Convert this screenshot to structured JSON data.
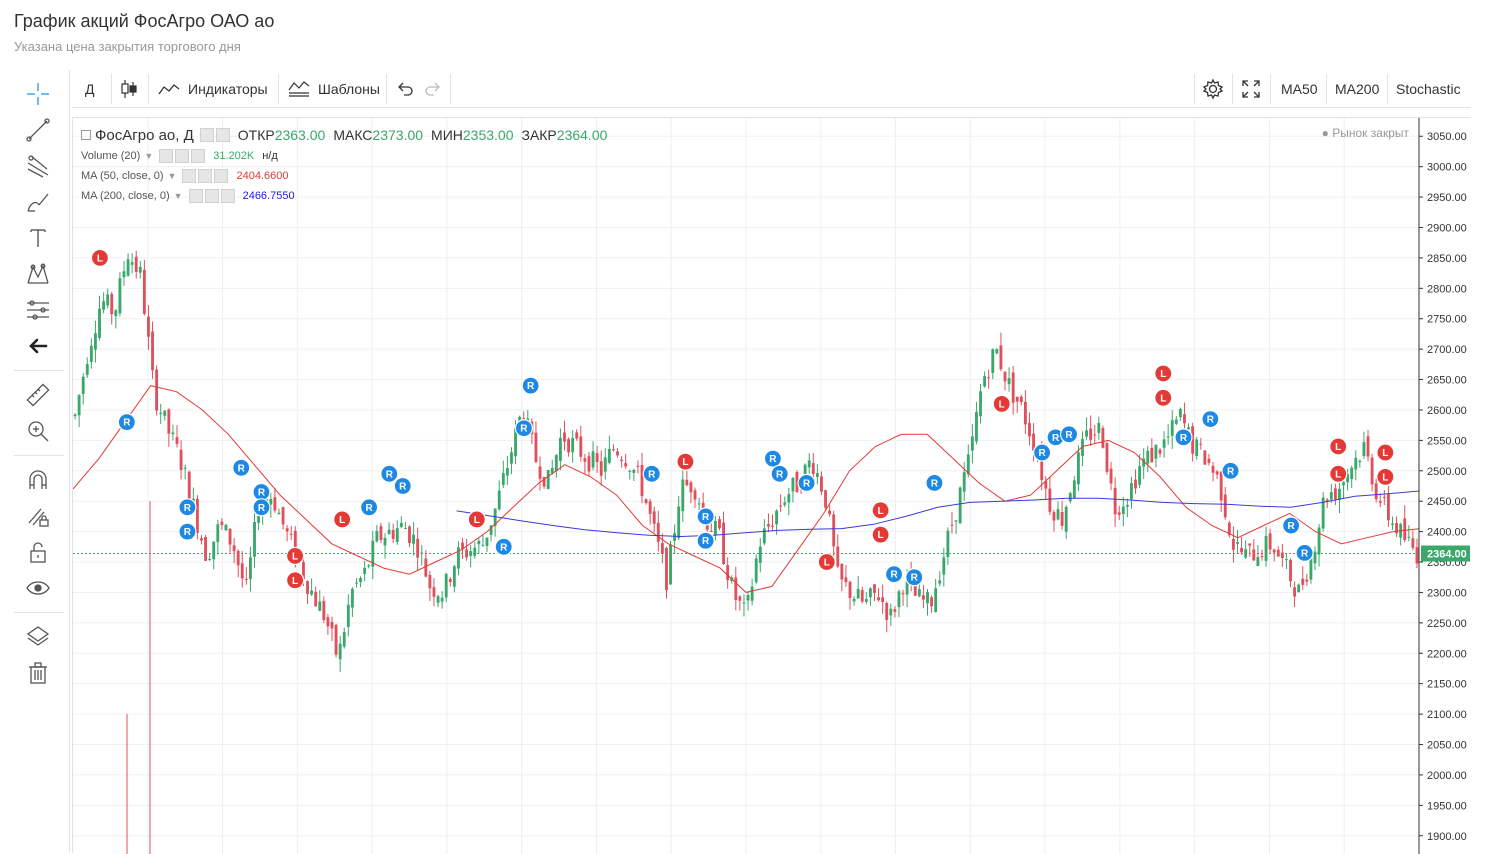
{
  "page": {
    "title": "График акций ФосАгро ОАО ао",
    "subtitle": "Указана цена закрытия торгового дня"
  },
  "toolbar": {
    "interval": "Д",
    "indicators_label": "Индикаторы",
    "templates_label": "Шаблоны",
    "ma50_label": "MA50",
    "ma200_label": "MA200",
    "stochastic_label": "Stochastic"
  },
  "left_tools": [
    "crosshair-icon",
    "trend-line-icon",
    "pitchfork-icon",
    "brush-icon",
    "text-icon",
    "pattern-icon",
    "prediction-icon",
    "back-arrow-icon",
    "ruler-icon",
    "zoom-in-icon",
    "magnet-icon",
    "lock-drawing-icon",
    "unlock-icon",
    "eye-icon",
    "layers-icon",
    "trash-icon"
  ],
  "legend": {
    "symbol": "ФосАгро ао, Д",
    "open_label": "ОТКР",
    "open": "2363.00",
    "high_label": "МАКС",
    "high": "2373.00",
    "low_label": "МИН",
    "low": "2353.00",
    "close_label": "ЗАКР",
    "close": "2364.00",
    "market_status": "● Рынок закрыт"
  },
  "indicators": [
    {
      "label": "Volume (20)",
      "value": "31.202K",
      "extra": "н/д",
      "color": "#3aa86b"
    },
    {
      "label": "MA (50, close, 0)",
      "value": "2404.6600",
      "color": "#e53935"
    },
    {
      "label": "MA (200, close, 0)",
      "value": "2466.7550",
      "color": "#1e1ee0"
    }
  ],
  "colors": {
    "up": "#3aa86b",
    "down": "#e0505c",
    "ma50": "#e53935",
    "ma200": "#3b3bd6",
    "marker_r": "#1e88e5",
    "marker_l": "#e53935",
    "last_price": "#3aa86b"
  },
  "chart_data": {
    "type": "candlestick",
    "ylim": [
      1870,
      3080
    ],
    "y_ticks": [
      "3050.00",
      "3000.00",
      "2950.00",
      "2900.00",
      "2850.00",
      "2800.00",
      "2750.00",
      "2700.00",
      "2650.00",
      "2600.00",
      "2550.00",
      "2500.00",
      "2450.00",
      "2400.00",
      "2350.00",
      "2300.00",
      "2250.00",
      "2200.00",
      "2150.00",
      "2100.00",
      "2050.00",
      "2000.00",
      "1950.00",
      "1900.00"
    ],
    "last_price": "2364.00",
    "close_path": [
      2590,
      2700,
      2780,
      2760,
      2860,
      2820,
      2630,
      2570,
      2520,
      2440,
      2360,
      2410,
      2380,
      2300,
      2450,
      2460,
      2400,
      2350,
      2300,
      2260,
      2190,
      2300,
      2330,
      2390,
      2400,
      2410,
      2380,
      2310,
      2300,
      2360,
      2370,
      2380,
      2440,
      2520,
      2600,
      2520,
      2480,
      2560,
      2540,
      2520,
      2500,
      2540,
      2520,
      2480,
      2400,
      2320,
      2470,
      2480,
      2420,
      2390,
      2300,
      2260,
      2380,
      2420,
      2460,
      2480,
      2520,
      2460,
      2320,
      2300,
      2280,
      2300,
      2260,
      2320,
      2290,
      2280,
      2360,
      2440,
      2520,
      2650,
      2700,
      2640,
      2600,
      2540,
      2450,
      2420,
      2500,
      2560,
      2570,
      2440,
      2460,
      2510,
      2530,
      2550,
      2590,
      2540,
      2520,
      2480,
      2380,
      2360,
      2370,
      2380,
      2340,
      2300,
      2360,
      2460,
      2470,
      2510,
      2540,
      2460,
      2420,
      2390,
      2364
    ],
    "ma50_path": [
      2470,
      2520,
      2580,
      2640,
      2630,
      2600,
      2560,
      2510,
      2460,
      2420,
      2380,
      2360,
      2340,
      2330,
      2350,
      2370,
      2400,
      2440,
      2480,
      2510,
      2490,
      2460,
      2410,
      2380,
      2360,
      2340,
      2300,
      2310,
      2370,
      2430,
      2500,
      2540,
      2560,
      2560,
      2520,
      2480,
      2450,
      2460,
      2500,
      2540,
      2550,
      2530,
      2490,
      2440,
      2410,
      2390,
      2410,
      2430,
      2400,
      2380,
      2390,
      2400,
      2404.66
    ],
    "ma200_path": [
      2434,
      2426,
      2418,
      2410,
      2403,
      2398,
      2394,
      2392,
      2394,
      2398,
      2402,
      2404,
      2405,
      2412,
      2425,
      2440,
      2448,
      2450,
      2452,
      2455,
      2455,
      2452,
      2448,
      2446,
      2445,
      2442,
      2440,
      2448,
      2458,
      2462,
      2466.76
    ],
    "markers": [
      {
        "label": "L",
        "price": 2850,
        "i": 0.02
      },
      {
        "label": "R",
        "price": 2580,
        "i": 0.04
      },
      {
        "label": "R",
        "price": 2440,
        "i": 0.085
      },
      {
        "label": "R",
        "price": 2400,
        "i": 0.085
      },
      {
        "label": "R",
        "price": 2505,
        "i": 0.125
      },
      {
        "label": "R",
        "price": 2465,
        "i": 0.14
      },
      {
        "label": "R",
        "price": 2440,
        "i": 0.14
      },
      {
        "label": "L",
        "price": 2360,
        "i": 0.165
      },
      {
        "label": "L",
        "price": 2320,
        "i": 0.165
      },
      {
        "label": "L",
        "price": 2420,
        "i": 0.2
      },
      {
        "label": "R",
        "price": 2440,
        "i": 0.22
      },
      {
        "label": "R",
        "price": 2495,
        "i": 0.235
      },
      {
        "label": "R",
        "price": 2475,
        "i": 0.245
      },
      {
        "label": "L",
        "price": 2420,
        "i": 0.3
      },
      {
        "label": "R",
        "price": 2375,
        "i": 0.32
      },
      {
        "label": "R",
        "price": 2570,
        "i": 0.335
      },
      {
        "label": "R",
        "price": 2640,
        "i": 0.34
      },
      {
        "label": "R",
        "price": 2495,
        "i": 0.43
      },
      {
        "label": "L",
        "price": 2515,
        "i": 0.455
      },
      {
        "label": "R",
        "price": 2425,
        "i": 0.47
      },
      {
        "label": "R",
        "price": 2385,
        "i": 0.47
      },
      {
        "label": "R",
        "price": 2520,
        "i": 0.52
      },
      {
        "label": "R",
        "price": 2495,
        "i": 0.525
      },
      {
        "label": "R",
        "price": 2480,
        "i": 0.545
      },
      {
        "label": "L",
        "price": 2350,
        "i": 0.56
      },
      {
        "label": "L",
        "price": 2435,
        "i": 0.6
      },
      {
        "label": "L",
        "price": 2395,
        "i": 0.6
      },
      {
        "label": "R",
        "price": 2330,
        "i": 0.61
      },
      {
        "label": "R",
        "price": 2325,
        "i": 0.625
      },
      {
        "label": "R",
        "price": 2480,
        "i": 0.64
      },
      {
        "label": "L",
        "price": 2610,
        "i": 0.69
      },
      {
        "label": "R",
        "price": 2530,
        "i": 0.72
      },
      {
        "label": "R",
        "price": 2555,
        "i": 0.73
      },
      {
        "label": "R",
        "price": 2560,
        "i": 0.74
      },
      {
        "label": "L",
        "price": 2660,
        "i": 0.81
      },
      {
        "label": "L",
        "price": 2620,
        "i": 0.81
      },
      {
        "label": "R",
        "price": 2555,
        "i": 0.825
      },
      {
        "label": "R",
        "price": 2585,
        "i": 0.845
      },
      {
        "label": "R",
        "price": 2500,
        "i": 0.86
      },
      {
        "label": "R",
        "price": 2410,
        "i": 0.905
      },
      {
        "label": "R",
        "price": 2365,
        "i": 0.915
      },
      {
        "label": "L",
        "price": 2540,
        "i": 0.94
      },
      {
        "label": "L",
        "price": 2495,
        "i": 0.94
      },
      {
        "label": "L",
        "price": 2530,
        "i": 0.975
      },
      {
        "label": "L",
        "price": 2490,
        "i": 0.975
      }
    ]
  }
}
